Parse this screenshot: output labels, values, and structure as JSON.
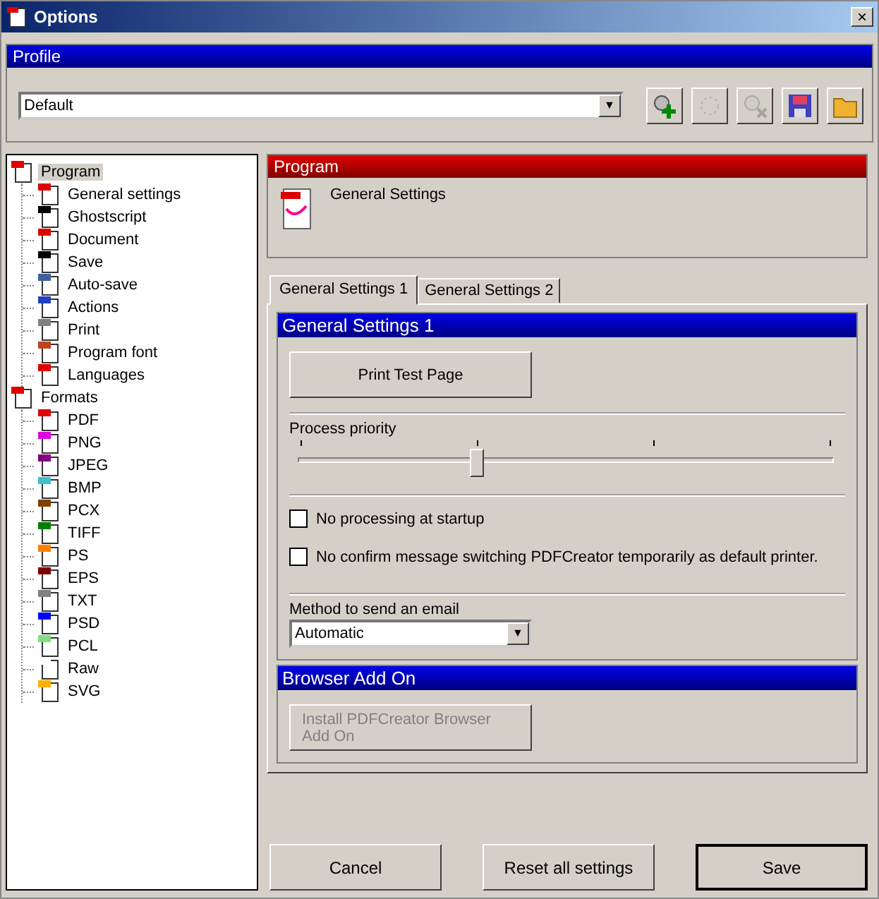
{
  "window": {
    "title": "Options",
    "close": "×"
  },
  "profile": {
    "header": "Profile",
    "value": "Default",
    "arrow": "▼",
    "toolbar": [
      {
        "kind": "add",
        "disabled": false
      },
      {
        "kind": "rename",
        "disabled": true
      },
      {
        "kind": "delete",
        "disabled": true
      },
      {
        "kind": "save",
        "disabled": false
      },
      {
        "kind": "open",
        "disabled": false
      }
    ]
  },
  "tree": [
    {
      "label": "Program",
      "selected": true,
      "color": "#e00000",
      "children": [
        {
          "label": "General settings",
          "selected": false,
          "color": "#e00000"
        },
        {
          "label": "Ghostscript",
          "selected": false,
          "color": "#000000"
        },
        {
          "label": "Document",
          "selected": false,
          "color": "#e00000"
        },
        {
          "label": "Save",
          "selected": false,
          "color": "#000000"
        },
        {
          "label": "Auto-save",
          "selected": false,
          "color": "#4060a0"
        },
        {
          "label": "Actions",
          "selected": false,
          "color": "#2040c0"
        },
        {
          "label": "Print",
          "selected": false,
          "color": "#808080"
        },
        {
          "label": "Program font",
          "selected": false,
          "color": "#c04020"
        },
        {
          "label": "Languages",
          "selected": false,
          "color": "#e00000"
        }
      ]
    },
    {
      "label": "Formats",
      "selected": false,
      "color": "#e00000",
      "children": [
        {
          "label": "PDF",
          "selected": false,
          "color": "#e00000"
        },
        {
          "label": "PNG",
          "selected": false,
          "color": "#e000e0"
        },
        {
          "label": "JPEG",
          "selected": false,
          "color": "#800080"
        },
        {
          "label": "BMP",
          "selected": false,
          "color": "#40c0d0"
        },
        {
          "label": "PCX",
          "selected": false,
          "color": "#804000"
        },
        {
          "label": "TIFF",
          "selected": false,
          "color": "#008000"
        },
        {
          "label": "PS",
          "selected": false,
          "color": "#ff8000"
        },
        {
          "label": "EPS",
          "selected": false,
          "color": "#800000"
        },
        {
          "label": "TXT",
          "selected": false,
          "color": "#808080"
        },
        {
          "label": "PSD",
          "selected": false,
          "color": "#0000ff"
        },
        {
          "label": "PCL",
          "selected": false,
          "color": "#80e080"
        },
        {
          "label": "Raw",
          "selected": false,
          "color": "#ffffff"
        },
        {
          "label": "SVG",
          "selected": false,
          "color": "#ffb000"
        }
      ]
    }
  ],
  "section": {
    "header": "Program",
    "title": "General Settings"
  },
  "tabs": [
    {
      "label": "General Settings 1",
      "selected": true
    },
    {
      "label": "General Settings 2",
      "selected": false
    }
  ],
  "group1": {
    "header": "General Settings 1",
    "print_button": "Print Test Page",
    "priority": {
      "label": "Process priority",
      "level": 0.333
    },
    "checkboxes": [
      {
        "label": "No processing at startup",
        "checked": false
      },
      {
        "label": "No confirm message switching PDFCreator temporarily as default printer.",
        "checked": false
      }
    ],
    "email": {
      "label": "Method to send an email",
      "value": "Automatic",
      "arrow": "▼"
    }
  },
  "group2": {
    "header": "Browser Add On",
    "button": {
      "label": "Install PDFCreator Browser Add On",
      "disabled": true
    }
  },
  "buttons": [
    {
      "label": "Cancel",
      "default": false
    },
    {
      "label": "Reset all settings",
      "default": false
    },
    {
      "label": "Save",
      "default": true
    }
  ]
}
